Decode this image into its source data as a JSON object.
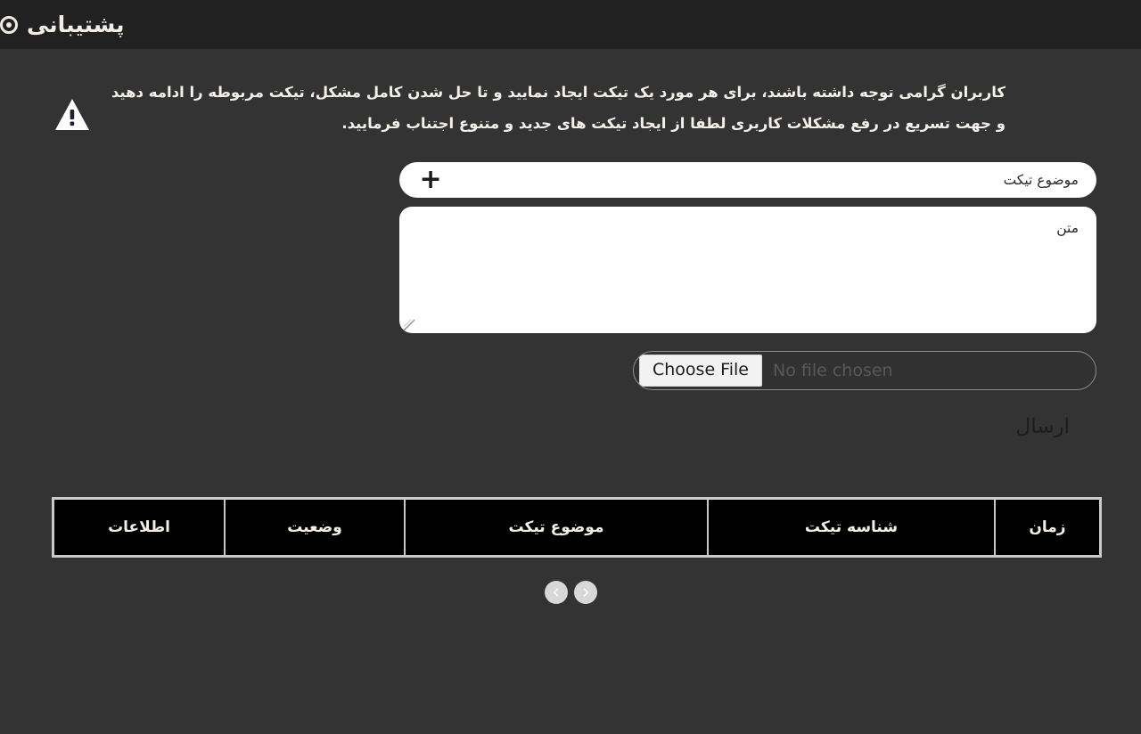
{
  "header": {
    "title": "پشتیبانی",
    "icon": "support-circle-icon"
  },
  "notice": {
    "icon": "warning-triangle-icon",
    "text": "کاربران گرامی توجه داشته باشند، برای هر مورد یک تیکت ایجاد نمایید و تا حل شدن کامل مشکل، تیکت مربوطه را ادامه دهید و جهت تسریع در رفع مشکلات کاربری لطفا از ایجاد تیکت های جدید و متنوع اجتناب فرمایید."
  },
  "form": {
    "subject_placeholder": "موضوع تیکت",
    "subject_value": "",
    "add_icon": "+",
    "body_placeholder": "متن",
    "body_value": "",
    "file": {
      "button_label": "Choose File",
      "status_text": "No file chosen"
    },
    "submit_label": "ارسال"
  },
  "table": {
    "columns": [
      {
        "key": "time",
        "label": "زمان"
      },
      {
        "key": "ticket_id",
        "label": "شناسه تیکت"
      },
      {
        "key": "subject",
        "label": "موضوع تیکت"
      },
      {
        "key": "status",
        "label": "وضعیت"
      },
      {
        "key": "info",
        "label": "اطلاعات"
      }
    ],
    "rows": []
  },
  "pagination": {
    "prev_icon": "chevron-left-icon",
    "next_icon": "chevron-right-icon",
    "prev_label": "‹",
    "next_label": "›"
  },
  "colors": {
    "page_background": "#333333",
    "header_background": "#212121",
    "text_light": "#f2eee6",
    "field_background": "#ffffff",
    "table_background": "#000000",
    "table_border": "#c9c9c9",
    "pager_button": "#d8d8d8"
  }
}
